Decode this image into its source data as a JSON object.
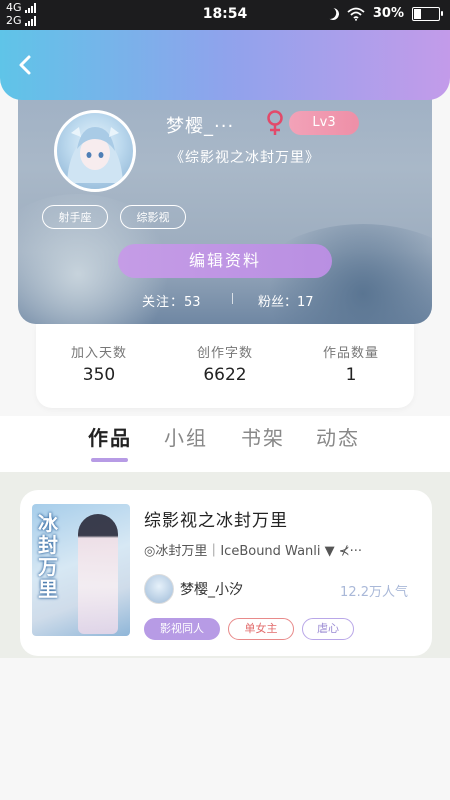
{
  "status_bar": {
    "network_top": "4G",
    "network_bottom": "2G",
    "time": "18:54",
    "battery": "30%",
    "battery_level": 0.3
  },
  "profile": {
    "username": "梦樱_···",
    "level": "Lv3",
    "signature": "《综影视之冰封万里》",
    "tags": [
      "射手座",
      "综影视"
    ],
    "edit_button": "编辑资料",
    "following_label": "关注：",
    "following_count": "53",
    "fans_label": "粉丝：",
    "fans_count": "17"
  },
  "stats": [
    {
      "label": "加入天数",
      "value": "350"
    },
    {
      "label": "创作字数",
      "value": "6622"
    },
    {
      "label": "作品数量",
      "value": "1"
    }
  ],
  "tabs": [
    "作品",
    "小组",
    "书架",
    "动态"
  ],
  "book": {
    "title": "综影视之冰封万里",
    "subtitle": "◎冰封万里｜IceBound Wanli ▼ ⊀···",
    "cover_title": "冰封万里",
    "author": "梦樱_小汐",
    "popularity": "12.2万人气",
    "tags": [
      "影视同人",
      "单女主",
      "虐心"
    ]
  },
  "colors": {
    "header_gradient_start": "#5fc4e8",
    "header_gradient_end": "#c39bea",
    "accent_purple": "#b79be5",
    "level_pink": "#ee8fa7",
    "gender_red": "#e24a6a"
  },
  "icons": {
    "back": "chevron-left-icon",
    "gender": "female-icon",
    "wifi": "wifi-icon",
    "moon": "moon-icon",
    "battery": "battery-icon"
  }
}
